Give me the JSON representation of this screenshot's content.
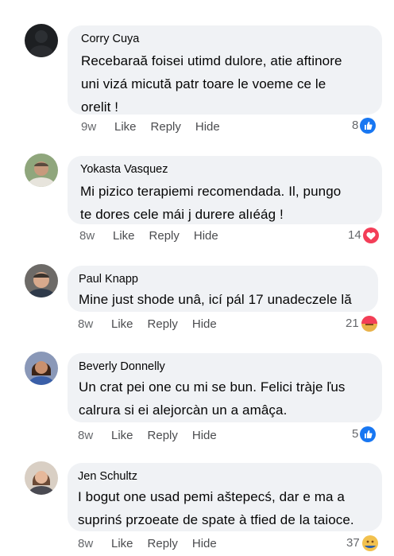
{
  "comments": [
    {
      "author": "Corry Cuya",
      "lines": [
        "Recebaraă foisei utimd dulore, atie aftinore",
        "uni vizá micută patr toare le voeme ce le",
        "orelit !"
      ],
      "time": "9w",
      "like": "Like",
      "reply": "Reply",
      "hide": "Hide",
      "reaction_count": "8",
      "reaction_icon": "like-icon"
    },
    {
      "author": "Yokasta Vasquez",
      "lines": [
        "Mi pizico terapiemi recomendada. Il, pungo",
        "te dores cele mái j durere alıéág !"
      ],
      "time": "8w",
      "like": "Like",
      "reply": "Reply",
      "hide": "Hide",
      "reaction_count": "14",
      "reaction_icon": "love-icon"
    },
    {
      "author": "Paul Knapp",
      "lines": [
        "Mine just shode unâ, icí pál 17 unadeczele lă"
      ],
      "time": "8w",
      "like": "Like",
      "reply": "Reply",
      "hide": "Hide",
      "reaction_count": "21",
      "reaction_icon": "like-love-icon"
    },
    {
      "author": "Beverly Donnelly",
      "lines": [
        "Un crat pei one cu mi se bun. Felici tràje ľus",
        "calrura si ei alejorcàn un a amâça."
      ],
      "time": "8w",
      "like": "Like",
      "reply": "Reply",
      "hide": "Hide",
      "reaction_count": "5",
      "reaction_icon": "like-icon"
    },
    {
      "author": "Jen Schultz",
      "lines": [
        "I bogut  one usad pemi aštepecś, dar e ma a",
        "suprinś przoeate de spate à tfied de la taioce."
      ],
      "time": "8w",
      "like": "Like",
      "reply": "Reply",
      "hide": "Hide",
      "reaction_count": "37",
      "reaction_icon": "like-love-icon"
    }
  ],
  "colors": {
    "bubble": "#f0f2f5",
    "like_blue": "#1877f2",
    "love_red": "#f33e58",
    "meta_gray": "#65676b"
  }
}
